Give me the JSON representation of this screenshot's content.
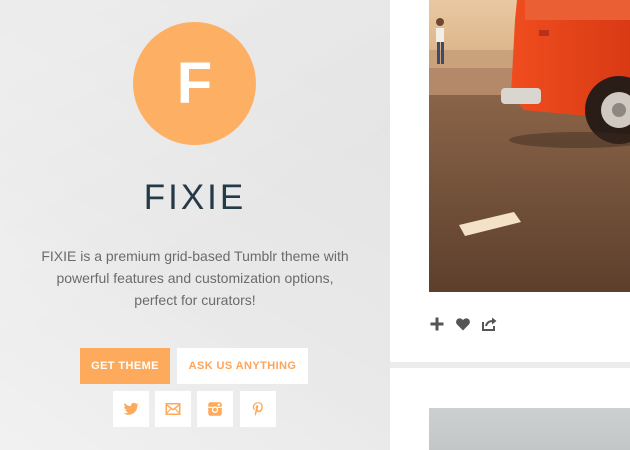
{
  "sidebar": {
    "logo_letter": "F",
    "title": "FIXIE",
    "description": "FIXIE is a premium grid-based Tumblr theme with powerful features and customization options, perfect for curators!",
    "buttons": {
      "get_theme": "GET THEME",
      "ask": "ASK US ANYTHING"
    },
    "social_icons": [
      "twitter-icon",
      "mail-icon",
      "instagram-icon",
      "pinterest-icon"
    ]
  },
  "post": {
    "actions": [
      "reblog-plus-icon",
      "like-heart-icon",
      "share-icon"
    ]
  },
  "colors": {
    "accent": "#fdb064",
    "title": "#243a47",
    "text": "#6b6b6b",
    "icon": "#555555"
  }
}
